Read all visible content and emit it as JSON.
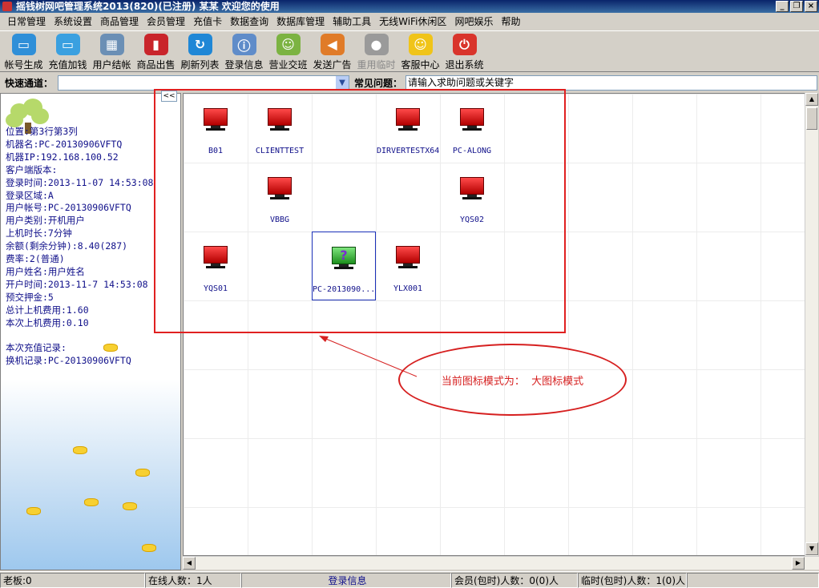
{
  "window": {
    "title": "摇钱树网吧管理系统2013(820)(已注册)  某某 欢迎您的使用"
  },
  "menu": [
    "日常管理",
    "系统设置",
    "商品管理",
    "会员管理",
    "充值卡",
    "数据查询",
    "数据库管理",
    "辅助工具",
    "无线WiFi休闲区",
    "网吧娱乐",
    "帮助"
  ],
  "toolbar": [
    {
      "label": "帐号生成",
      "icon": "account-generate-icon",
      "color": "#2f8fd8",
      "glyph": "▭"
    },
    {
      "label": "充值加钱",
      "icon": "recharge-icon",
      "color": "#3aa0e0",
      "glyph": "▭"
    },
    {
      "label": "用户结帐",
      "icon": "calculator-icon",
      "color": "#6b8fb5",
      "glyph": "▦"
    },
    {
      "label": "商品出售",
      "icon": "cola-can-icon",
      "color": "#c9252b",
      "glyph": "▮"
    },
    {
      "label": "刷新列表",
      "icon": "refresh-icon",
      "color": "#1f87d6",
      "glyph": "↻"
    },
    {
      "label": "登录信息",
      "icon": "users-info-icon",
      "color": "#5f8cc9",
      "glyph": "ⓘ"
    },
    {
      "label": "营业交班",
      "icon": "shift-handover-icon",
      "color": "#7cb342",
      "glyph": "☺"
    },
    {
      "label": "发送广告",
      "icon": "megaphone-icon",
      "color": "#e07b28",
      "glyph": "◀"
    },
    {
      "label": "重用临时",
      "icon": "reuse-temp-icon",
      "color": "#9a9a9a",
      "glyph": "●",
      "disabled": true
    },
    {
      "label": "客服中心",
      "icon": "customer-service-icon",
      "color": "#f0c419",
      "glyph": "☺"
    },
    {
      "label": "退出系统",
      "icon": "power-icon",
      "color": "#d9342b",
      "glyph": "⏻"
    }
  ],
  "quick": {
    "channel_label": "快速通道：",
    "faq_label": "常见问题：",
    "faq_placeholder": "请输入求助问题或关键字"
  },
  "left_info": [
    "位置:第3行第3列",
    "机器名:PC-20130906VFTQ",
    "机器IP:192.168.100.52",
    "客户端版本:",
    "登录时间:2013-11-07 14:53:08",
    "登录区域:A",
    "用户帐号:PC-20130906VFTQ",
    "用户类别:开机用户",
    "上机时长:7分钟",
    "余额(剩余分钟):8.40(287)",
    "费率:2(普通)",
    "用户姓名:用户姓名",
    "开户时间:2013-11-7 14:53:08",
    "预交押金:5",
    "总计上机费用:1.60",
    "本次上机费用:0.10",
    "",
    "本次充值记录:",
    "换机记录:PC-20130906VFTQ"
  ],
  "computers": [
    {
      "name": "B01",
      "state": "offline",
      "row": 0,
      "col": 0
    },
    {
      "name": "CLIENTTEST",
      "state": "offline",
      "row": 0,
      "col": 1
    },
    {
      "name": "DIRVERTESTX64",
      "state": "offline",
      "row": 0,
      "col": 3
    },
    {
      "name": "PC-ALONG",
      "state": "offline",
      "row": 0,
      "col": 4
    },
    {
      "name": "VBBG",
      "state": "offline",
      "row": 1,
      "col": 1
    },
    {
      "name": "YQS02",
      "state": "offline",
      "row": 1,
      "col": 4
    },
    {
      "name": "YQS01",
      "state": "offline",
      "row": 2,
      "col": 0
    },
    {
      "name": "PC-2013090...",
      "state": "unknown",
      "row": 2,
      "col": 2,
      "selected": true
    },
    {
      "name": "YLX001",
      "state": "offline",
      "row": 2,
      "col": 3
    }
  ],
  "annotation": {
    "text": "当前图标模式为：  大图标模式"
  },
  "status": {
    "boss": "老板:0",
    "online": "在线人数：1人",
    "login_info": "登录信息",
    "member": "会员(包时)人数：0(0)人",
    "temp": "临时(包时)人数：1(0)人"
  }
}
